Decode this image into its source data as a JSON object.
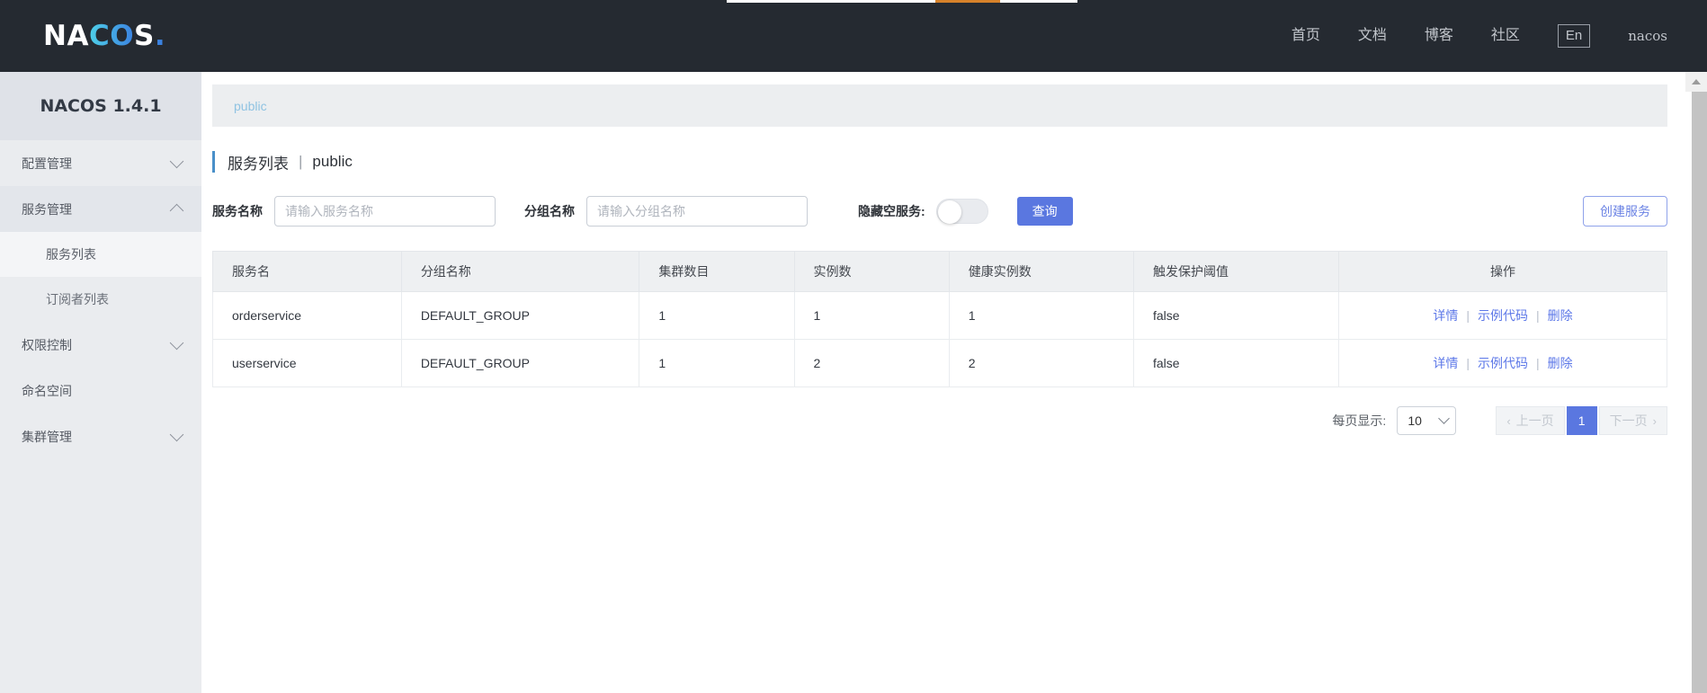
{
  "brand": {
    "logo_part1": "NA",
    "logo_part2": "CO",
    "logo_part3": "S",
    "logo_dot": "."
  },
  "topnav": {
    "items": [
      {
        "label": "首页"
      },
      {
        "label": "文档"
      },
      {
        "label": "博客"
      },
      {
        "label": "社区"
      }
    ],
    "language": "En",
    "user": "nacos"
  },
  "sidebar": {
    "version_title": "NACOS 1.4.1",
    "items": [
      {
        "label": "配置管理",
        "type": "group",
        "expanded": false
      },
      {
        "label": "服务管理",
        "type": "group",
        "expanded": true
      },
      {
        "label": "服务列表",
        "type": "sub",
        "active": true
      },
      {
        "label": "订阅者列表",
        "type": "sub",
        "active": false
      },
      {
        "label": "权限控制",
        "type": "group",
        "expanded": false
      },
      {
        "label": "命名空间",
        "type": "plain"
      },
      {
        "label": "集群管理",
        "type": "group",
        "expanded": false
      }
    ]
  },
  "breadcrumb": {
    "namespace": "public"
  },
  "page": {
    "title": "服务列表",
    "separator": "|",
    "namespace": "public"
  },
  "filters": {
    "service_name_label": "服务名称",
    "service_name_value": "",
    "service_name_placeholder": "请输入服务名称",
    "group_name_label": "分组名称",
    "group_name_value": "",
    "group_name_placeholder": "请输入分组名称",
    "hide_empty_label": "隐藏空服务:",
    "hide_empty_value": false,
    "query_button": "查询",
    "create_button": "创建服务"
  },
  "table": {
    "columns": [
      "服务名",
      "分组名称",
      "集群数目",
      "实例数",
      "健康实例数",
      "触发保护阈值",
      "操作"
    ],
    "rows": [
      {
        "service": "orderservice",
        "group": "DEFAULT_GROUP",
        "clusters": "1",
        "instances": "1",
        "healthy": "1",
        "threshold": "false"
      },
      {
        "service": "userservice",
        "group": "DEFAULT_GROUP",
        "clusters": "1",
        "instances": "2",
        "healthy": "2",
        "threshold": "false"
      }
    ],
    "actions": {
      "detail": "详情",
      "sample_code": "示例代码",
      "delete": "删除",
      "separator": "|"
    }
  },
  "pagination": {
    "page_size_label": "每页显示:",
    "page_size_value": "10",
    "prev_label": "上一页",
    "next_label": "下一页",
    "prev_arrow": "‹",
    "next_arrow": "›",
    "current_page": "1"
  },
  "colors": {
    "topbar_bg": "#252a31",
    "sidebar_bg": "#eaecef",
    "primary": "#5a77e0",
    "link": "#5d78e8",
    "breadcrumb_link": "#8fc3e2",
    "title_accent": "#4a90c9",
    "loading_accent": "#d6812a"
  }
}
